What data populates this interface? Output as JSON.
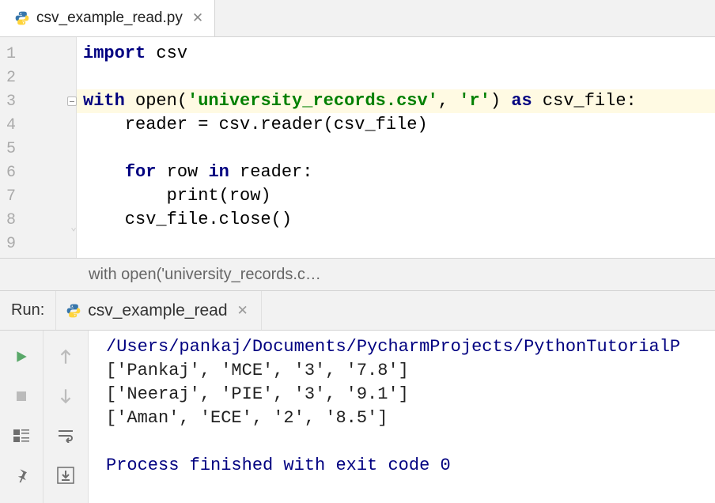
{
  "tab": {
    "filename": "csv_example_read.py"
  },
  "gutter": {
    "lines": [
      "1",
      "2",
      "3",
      "4",
      "5",
      "6",
      "7",
      "8",
      "9"
    ]
  },
  "code": {
    "highlightedLine": 3,
    "lines": [
      {
        "segments": [
          {
            "t": "import",
            "c": "kw"
          },
          {
            "t": " csv"
          }
        ]
      },
      {
        "segments": [
          {
            "t": ""
          }
        ]
      },
      {
        "segments": [
          {
            "t": "with",
            "c": "kw"
          },
          {
            "t": " open("
          },
          {
            "t": "'university_records.csv'",
            "c": "str"
          },
          {
            "t": ", "
          },
          {
            "t": "'r'",
            "c": "str"
          },
          {
            "t": ") "
          },
          {
            "t": "as",
            "c": "kw"
          },
          {
            "t": " csv_file:"
          }
        ]
      },
      {
        "segments": [
          {
            "t": "    reader = csv.reader(csv_file)"
          }
        ]
      },
      {
        "segments": [
          {
            "t": ""
          }
        ]
      },
      {
        "segments": [
          {
            "t": "    "
          },
          {
            "t": "for",
            "c": "kw"
          },
          {
            "t": " row "
          },
          {
            "t": "in",
            "c": "kw"
          },
          {
            "t": " reader:"
          }
        ]
      },
      {
        "segments": [
          {
            "t": "        print(row)"
          }
        ]
      },
      {
        "segments": [
          {
            "t": "    csv_file.close()"
          }
        ]
      },
      {
        "segments": [
          {
            "t": ""
          }
        ]
      }
    ]
  },
  "breadcrumb": {
    "text": "with open('university_records.c…"
  },
  "run": {
    "label": "Run:",
    "tabName": "csv_example_read"
  },
  "console": {
    "path": "/Users/pankaj/Documents/PycharmProjects/PythonTutorialP",
    "rows": [
      "['Pankaj', 'MCE', '3', '7.8']",
      "['Neeraj', 'PIE', '3', '9.1']",
      "['Aman', 'ECE', '2', '8.5']"
    ],
    "exit": "Process finished with exit code 0"
  }
}
